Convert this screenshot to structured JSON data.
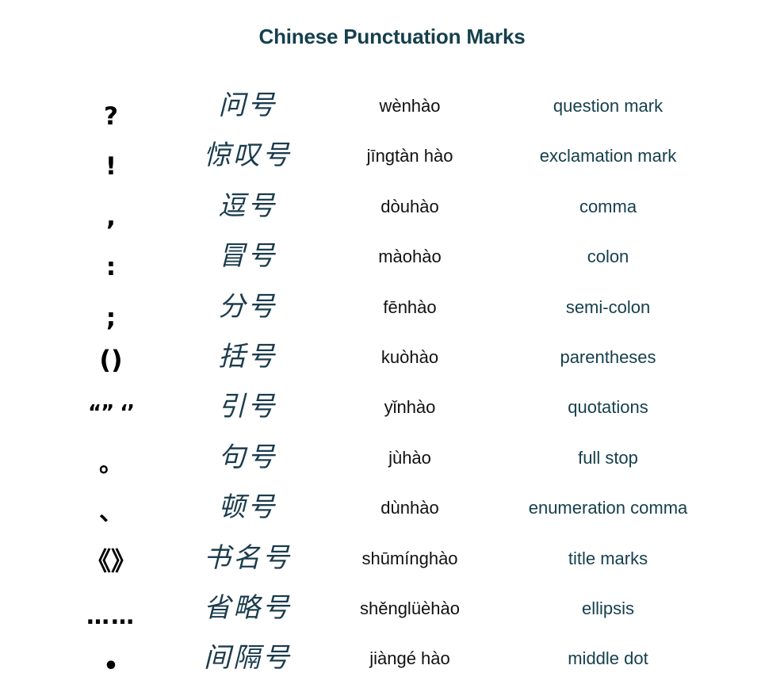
{
  "page": {
    "title": "Chinese Punctuation Marks",
    "background_color": "#ffffff",
    "title_color": "#16404d",
    "symbol_color": "#000000",
    "hanzi_color": "#1b3c4d",
    "pinyin_color": "#111111",
    "english_color": "#16404d"
  },
  "table": {
    "columns": [
      "symbol",
      "hanzi",
      "pinyin",
      "english"
    ],
    "rows": [
      {
        "symbol": "?",
        "hanzi": "问号",
        "pinyin": "wènhào",
        "english": "question mark"
      },
      {
        "symbol": "!",
        "hanzi": "惊叹号",
        "pinyin": "jīngtàn hào",
        "english": "exclamation mark"
      },
      {
        "symbol": ",",
        "hanzi": "逗号",
        "pinyin": "dòuhào",
        "english": "comma"
      },
      {
        "symbol": ":",
        "hanzi": "冒号",
        "pinyin": "màohào",
        "english": "colon"
      },
      {
        "symbol": ";",
        "hanzi": "分号",
        "pinyin": "fēnhào",
        "english": "semi-colon"
      },
      {
        "symbol": "()",
        "hanzi": "括号",
        "pinyin": "kuòhào",
        "english": "parentheses"
      },
      {
        "symbol": "“” ‘’",
        "hanzi": "引号",
        "pinyin": "yǐnhào",
        "english": "quotations"
      },
      {
        "symbol": "。",
        "hanzi": "句号",
        "pinyin": "jùhào",
        "english": "full stop"
      },
      {
        "symbol": "、",
        "hanzi": "顿号",
        "pinyin": "dùnhào",
        "english": "enumeration comma"
      },
      {
        "symbol": "《》",
        "hanzi": "书名号",
        "pinyin": "shūmínghào",
        "english": "title marks"
      },
      {
        "symbol": "……",
        "hanzi": "省略号",
        "pinyin": "shěnglüèhào",
        "english": "ellipsis"
      },
      {
        "symbol": "•",
        "hanzi": "间隔号",
        "pinyin": "jiàngé hào",
        "english": "middle dot"
      }
    ]
  }
}
